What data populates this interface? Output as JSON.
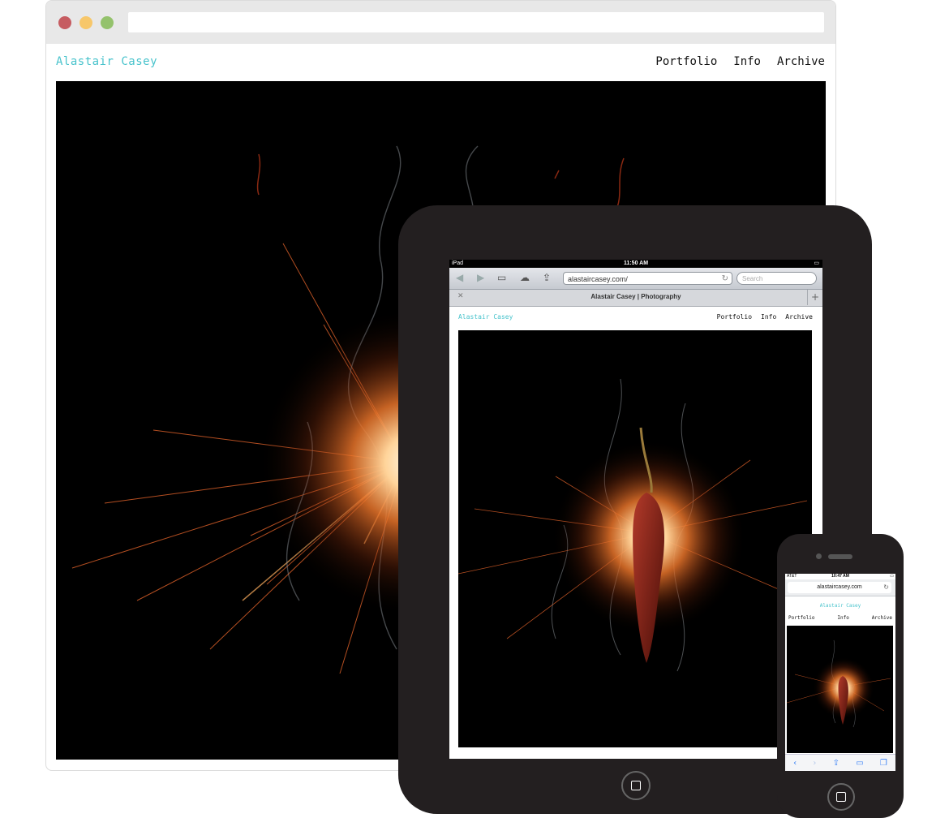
{
  "desktop": {
    "brand": "Alastair Casey",
    "nav": [
      "Portfolio",
      "Info",
      "Archive"
    ],
    "hero_icon": "sparkler-explosion-photo"
  },
  "ipad": {
    "status": {
      "left": "iPad",
      "time": "11:50 AM"
    },
    "toolbar_icons": [
      "back-icon",
      "forward-icon",
      "bookmarks-icon",
      "icloud-icon",
      "share-icon"
    ],
    "address": "alastaircasey.com/",
    "search_placeholder": "Search",
    "tab_title": "Alastair Casey | Photography",
    "brand": "Alastair Casey",
    "nav": [
      "Portfolio",
      "Info",
      "Archive"
    ],
    "hero_icon": "burning-chili-pepper-photo"
  },
  "iphone": {
    "status": {
      "carrier": "AT&T",
      "time": "10:47 AM"
    },
    "address": "alastaircasey.com",
    "brand": "Alastair Casey",
    "nav": [
      "Portfolio",
      "Info",
      "Archive"
    ],
    "hero_icon": "burning-chili-pepper-photo",
    "toolbar_icons": [
      "back-icon",
      "forward-icon",
      "share-icon",
      "bookmarks-icon",
      "tabs-icon"
    ]
  },
  "colors": {
    "brand": "#48c3cc",
    "device": "#231f20",
    "close": "#c65c61",
    "minimize": "#f7c76a",
    "maximize": "#94c26c"
  }
}
